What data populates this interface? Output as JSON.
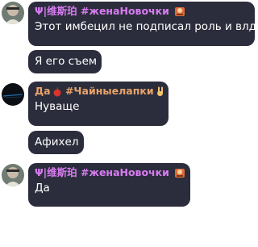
{
  "messages": [
    {
      "author": "Ψ|维斯珀 #женаНовочки",
      "text": "Этот имбецил не подписал роль и влд"
    },
    {
      "author": "",
      "text": "Я его съем"
    },
    {
      "author": "Да",
      "tag": "#Чайныелапки",
      "text": "Нуваще"
    },
    {
      "author": "",
      "text": "Афихел"
    },
    {
      "author": "Ψ|维斯珀 #женаНовочки",
      "text": "Да"
    }
  ],
  "colors": {
    "bubble": "#2b2d3c",
    "author_name": "#d97cf2",
    "author_name_alt": "#e8a36a",
    "text": "#ffffff"
  },
  "icons": [
    "avatar-vesper",
    "avatar-dark",
    "sticker-icon",
    "fruit-icon",
    "rock-hand-icon"
  ]
}
